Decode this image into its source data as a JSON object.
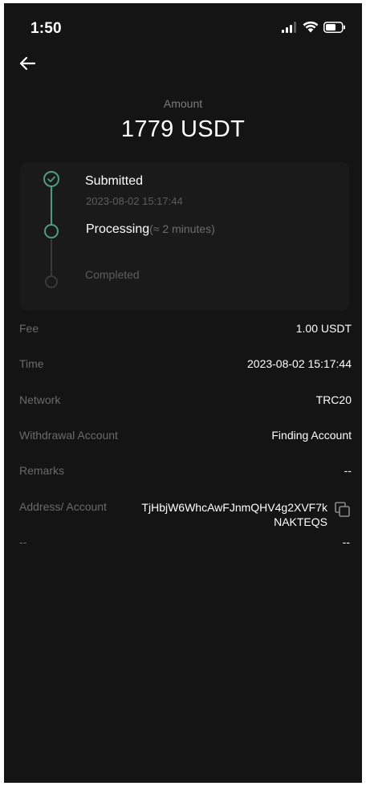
{
  "status_bar": {
    "time": "1:50",
    "icons": [
      "signal-icon",
      "wifi-icon",
      "battery-icon"
    ]
  },
  "nav": {
    "back_icon": "back-arrow-icon"
  },
  "amount": {
    "label": "Amount",
    "value": "1779 USDT"
  },
  "timeline": {
    "steps": [
      {
        "title": "Submitted",
        "subtitle": "2023-08-02 15:17:44",
        "state": "done"
      },
      {
        "title": "Processing",
        "subtitle": "(≈ 2 minutes)",
        "state": "active"
      },
      {
        "title": "Completed",
        "subtitle": "",
        "state": "pending"
      }
    ]
  },
  "details": {
    "fee": {
      "label": "Fee",
      "value": "1.00 USDT"
    },
    "time": {
      "label": "Time",
      "value": "2023-08-02 15:17:44"
    },
    "network": {
      "label": "Network",
      "value": "TRC20"
    },
    "withdrawal_account": {
      "label": "Withdrawal Account",
      "value": "Finding Account"
    },
    "remarks": {
      "label": "Remarks",
      "value": "--"
    },
    "address": {
      "label": "Address/ Account",
      "value": "TjHbjW6WhcAwFJnmQHV4g2XVF7kNAKTEQS",
      "copy_icon": "copy-icon"
    },
    "extra": {
      "label": "--",
      "value": "--"
    }
  },
  "colors": {
    "background": "#141414",
    "card": "#1a1a1a",
    "accent": "#4e9d83",
    "muted_text": "#6a6a6a",
    "primary_text": "#ffffff"
  }
}
